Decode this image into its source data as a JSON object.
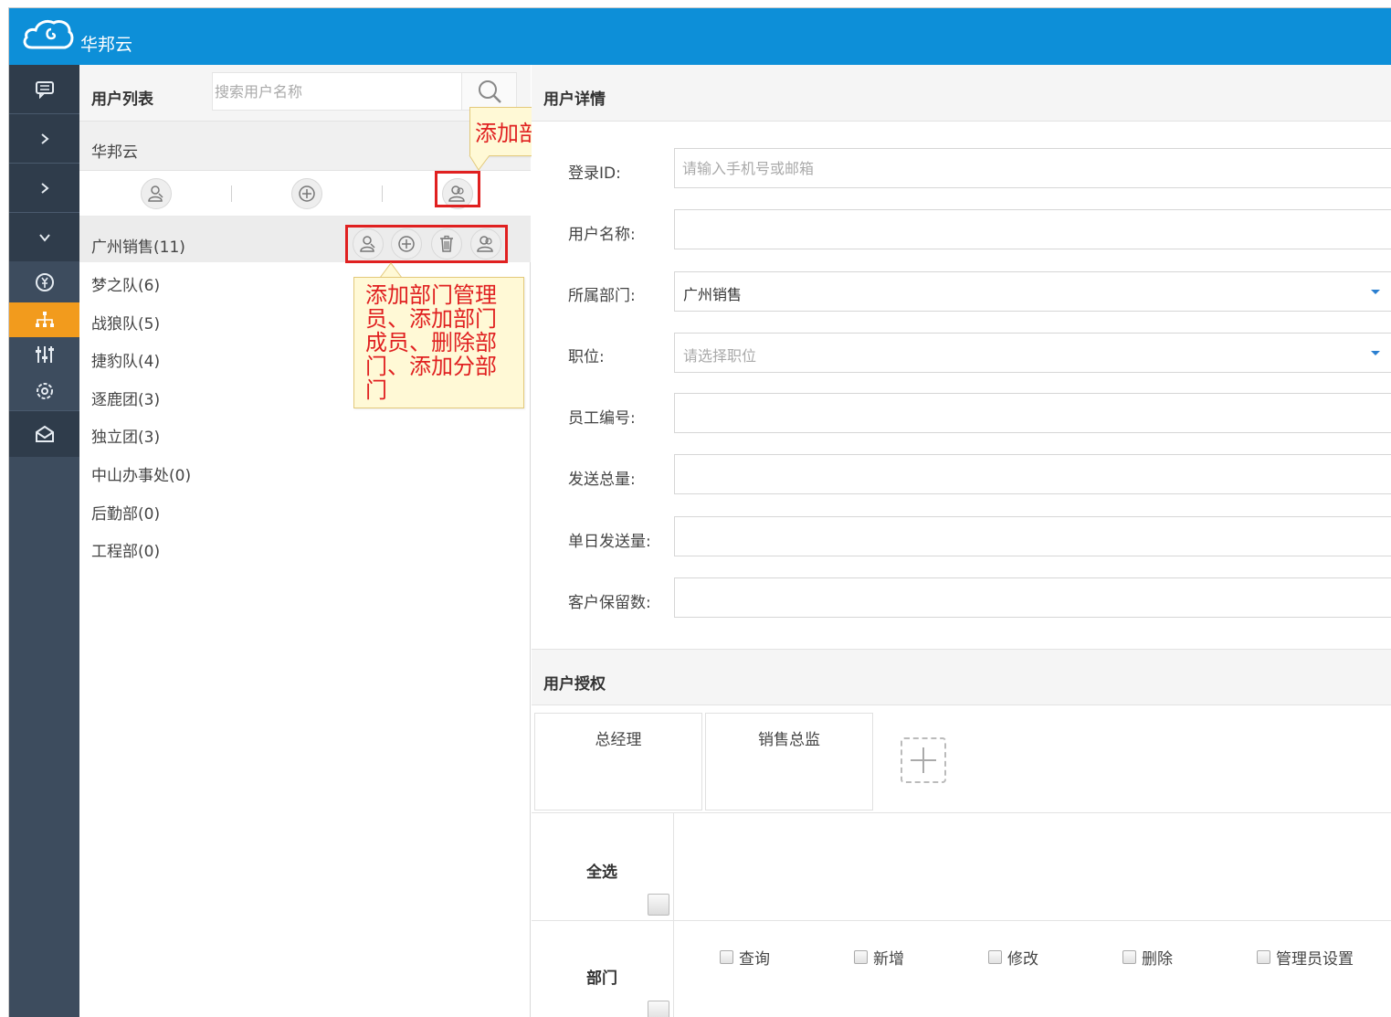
{
  "app": {
    "brand": "华邦云"
  },
  "colors": {
    "header": "#0d8fd8",
    "rail": "#3d4c5e",
    "rail_active": "#f29b1d",
    "highlight": "#e02020",
    "callout_bg": "#fff9d6"
  },
  "rail": {
    "items": [
      {
        "icon": "chat-icon"
      },
      {
        "icon": "chevron-right-icon"
      },
      {
        "icon": "chevron-right-icon"
      },
      {
        "icon": "chevron-down-icon"
      },
      {
        "icon": "currency-icon"
      },
      {
        "icon": "org-chart-icon",
        "active": true
      },
      {
        "icon": "sliders-icon"
      },
      {
        "icon": "settings-icon"
      },
      {
        "icon": "mail-icon"
      }
    ]
  },
  "user_list": {
    "title": "用户列表",
    "search_placeholder": "搜索用户名称",
    "org_name": "华邦云",
    "toolbar_icons": [
      "manager-icon",
      "add-circle-icon",
      "add-department-icon"
    ],
    "row_icons": [
      "manager-icon",
      "add-circle-icon",
      "trash-icon",
      "add-department-icon"
    ],
    "departments": [
      {
        "label": "广州销售(11)",
        "selected": true
      },
      {
        "label": "梦之队(6)"
      },
      {
        "label": "战狼队(5)"
      },
      {
        "label": "捷豹队(4)"
      },
      {
        "label": "逐鹿团(3)"
      },
      {
        "label": "独立团(3)"
      },
      {
        "label": "中山办事处(0)"
      },
      {
        "label": "后勤部(0)"
      },
      {
        "label": "工程部(0)"
      }
    ]
  },
  "callouts": {
    "add_department": "添加部门",
    "row_actions": "添加部门管理员、添加部门成员、删除部门、添加分部门"
  },
  "user_detail": {
    "title": "用户详情",
    "fields": {
      "login_id": {
        "label": "登录ID:",
        "placeholder": "请输入手机号或邮箱"
      },
      "user_name": {
        "label": "用户名称:"
      },
      "department": {
        "label": "所属部门:",
        "value": "广州销售"
      },
      "position": {
        "label": "职位:",
        "placeholder": "请选择职位"
      },
      "employee_no": {
        "label": "员工编号:"
      },
      "send_total": {
        "label": "发送总量:"
      },
      "daily_send": {
        "label": "单日发送量:"
      },
      "customer_retain": {
        "label": "客户保留数:"
      }
    }
  },
  "user_auth": {
    "title": "用户授权",
    "roles": [
      "总经理",
      "销售总监"
    ],
    "select_all": "全选",
    "department_label": "部门",
    "permissions": [
      "查询",
      "新增",
      "修改",
      "删除",
      "管理员设置"
    ]
  }
}
